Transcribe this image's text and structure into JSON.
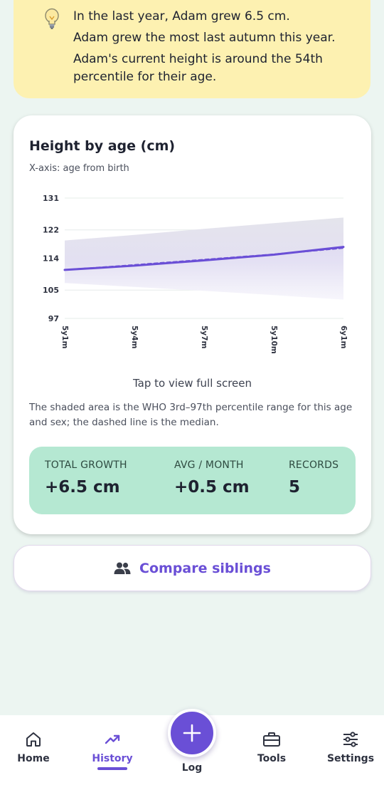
{
  "insights": {
    "icon": "lightbulb-icon",
    "lines": [
      "In the last year, Adam grew 6.5 cm.",
      "Adam grew the most last autumn this year.",
      "Adam's current height is around the 54th percentile for their age."
    ]
  },
  "chart_card": {
    "title": "Height by age (cm)",
    "subtitle": "X-axis: age from birth",
    "tap_hint": "Tap to view full screen",
    "note": "The shaded area is the WHO 3rd–97th percentile range for this age and sex; the dashed line is the median."
  },
  "chart_data": {
    "type": "line",
    "title": "Height by age (cm)",
    "xlabel": "X-axis: age from birth",
    "ylabel": "",
    "x_ticks": [
      "5y1m",
      "5y4m",
      "5y7m",
      "5y10m",
      "6y1m"
    ],
    "y_ticks": [
      97,
      105,
      114,
      122,
      131
    ],
    "ylim": [
      97,
      131
    ],
    "grid": true,
    "series": [
      {
        "values": [
          110.7,
          111.9,
          113.4,
          115.0,
          117.2
        ],
        "color": "#6a4fd6",
        "style": "solid"
      },
      {
        "values": [
          110.7,
          112.1,
          113.6,
          115.1,
          116.9
        ],
        "color": "#6a4fd6",
        "style": "dashed"
      }
    ],
    "band": {
      "upper": [
        119.0,
        120.6,
        122.3,
        123.9,
        125.5
      ],
      "lower": [
        107.0,
        105.9,
        104.8,
        103.6,
        102.3
      ]
    }
  },
  "stats": [
    {
      "label": "TOTAL GROWTH",
      "value": "+6.5 cm"
    },
    {
      "label": "AVG / MONTH",
      "value": "+0.5 cm"
    },
    {
      "label": "RECORDS",
      "value": "5"
    }
  ],
  "compare": {
    "label": "Compare siblings",
    "icon": "people-icon"
  },
  "nav": {
    "home": "Home",
    "history": "History",
    "log": "Log",
    "tools": "Tools",
    "settings": "Settings"
  },
  "colors": {
    "accent": "#6a4fd6",
    "banner": "#fdf1b1",
    "stats_bg": "#b5e8d2",
    "page_bg": "#ecf5f1"
  }
}
